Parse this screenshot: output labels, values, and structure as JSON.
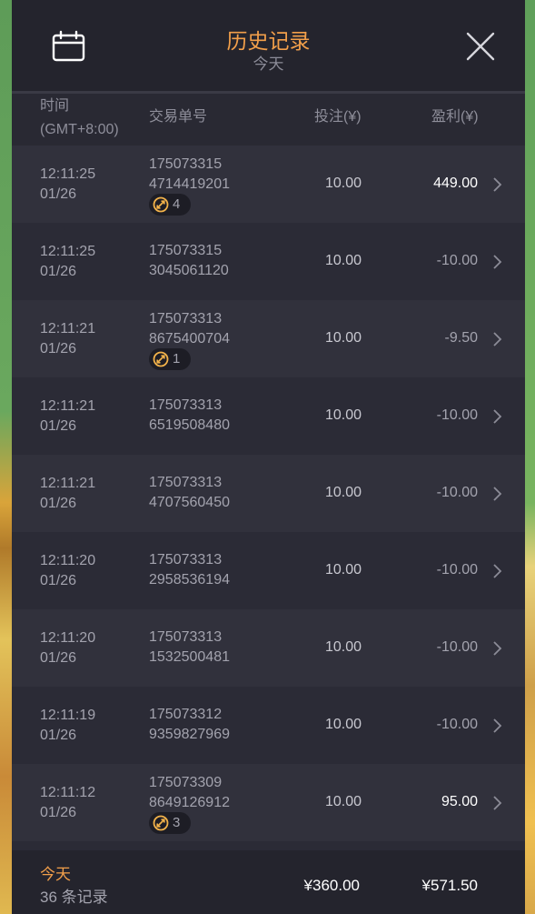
{
  "header": {
    "title": "历史记录",
    "subtitle": "今天",
    "calendar_icon": "calendar-icon",
    "close_icon": "close-icon",
    "accent_color": "#f29f4a"
  },
  "columns": {
    "time": "时间",
    "timezone": "(GMT+8:00)",
    "order": "交易单号",
    "bet": "投注(¥)",
    "profit": "盈利(¥)"
  },
  "records": [
    {
      "time": "12:11:25",
      "date": "01/26",
      "order1": "175073315",
      "order2": "4714419201",
      "badge": "4",
      "bet": "10.00",
      "profit": "449.00",
      "positive": true
    },
    {
      "time": "12:11:25",
      "date": "01/26",
      "order1": "175073315",
      "order2": "3045061120",
      "badge": null,
      "bet": "10.00",
      "profit": "-10.00",
      "positive": false
    },
    {
      "time": "12:11:21",
      "date": "01/26",
      "order1": "175073313",
      "order2": "8675400704",
      "badge": "1",
      "bet": "10.00",
      "profit": "-9.50",
      "positive": false
    },
    {
      "time": "12:11:21",
      "date": "01/26",
      "order1": "175073313",
      "order2": "6519508480",
      "badge": null,
      "bet": "10.00",
      "profit": "-10.00",
      "positive": false
    },
    {
      "time": "12:11:21",
      "date": "01/26",
      "order1": "175073313",
      "order2": "4707560450",
      "badge": null,
      "bet": "10.00",
      "profit": "-10.00",
      "positive": false
    },
    {
      "time": "12:11:20",
      "date": "01/26",
      "order1": "175073313",
      "order2": "2958536194",
      "badge": null,
      "bet": "10.00",
      "profit": "-10.00",
      "positive": false
    },
    {
      "time": "12:11:20",
      "date": "01/26",
      "order1": "175073313",
      "order2": "1532500481",
      "badge": null,
      "bet": "10.00",
      "profit": "-10.00",
      "positive": false
    },
    {
      "time": "12:11:19",
      "date": "01/26",
      "order1": "175073312",
      "order2": "9359827969",
      "badge": null,
      "bet": "10.00",
      "profit": "-10.00",
      "positive": false
    },
    {
      "time": "12:11:12",
      "date": "01/26",
      "order1": "175073309",
      "order2": "8649126912",
      "badge": "3",
      "bet": "10.00",
      "profit": "95.00",
      "positive": true
    }
  ],
  "row_icons": {
    "badge": "free-spin-icon",
    "chevron": "chevron-right-icon"
  },
  "footer": {
    "label": "今天",
    "count": "36 条记录",
    "total_bet": "¥360.00",
    "total_profit": "¥571.50"
  }
}
